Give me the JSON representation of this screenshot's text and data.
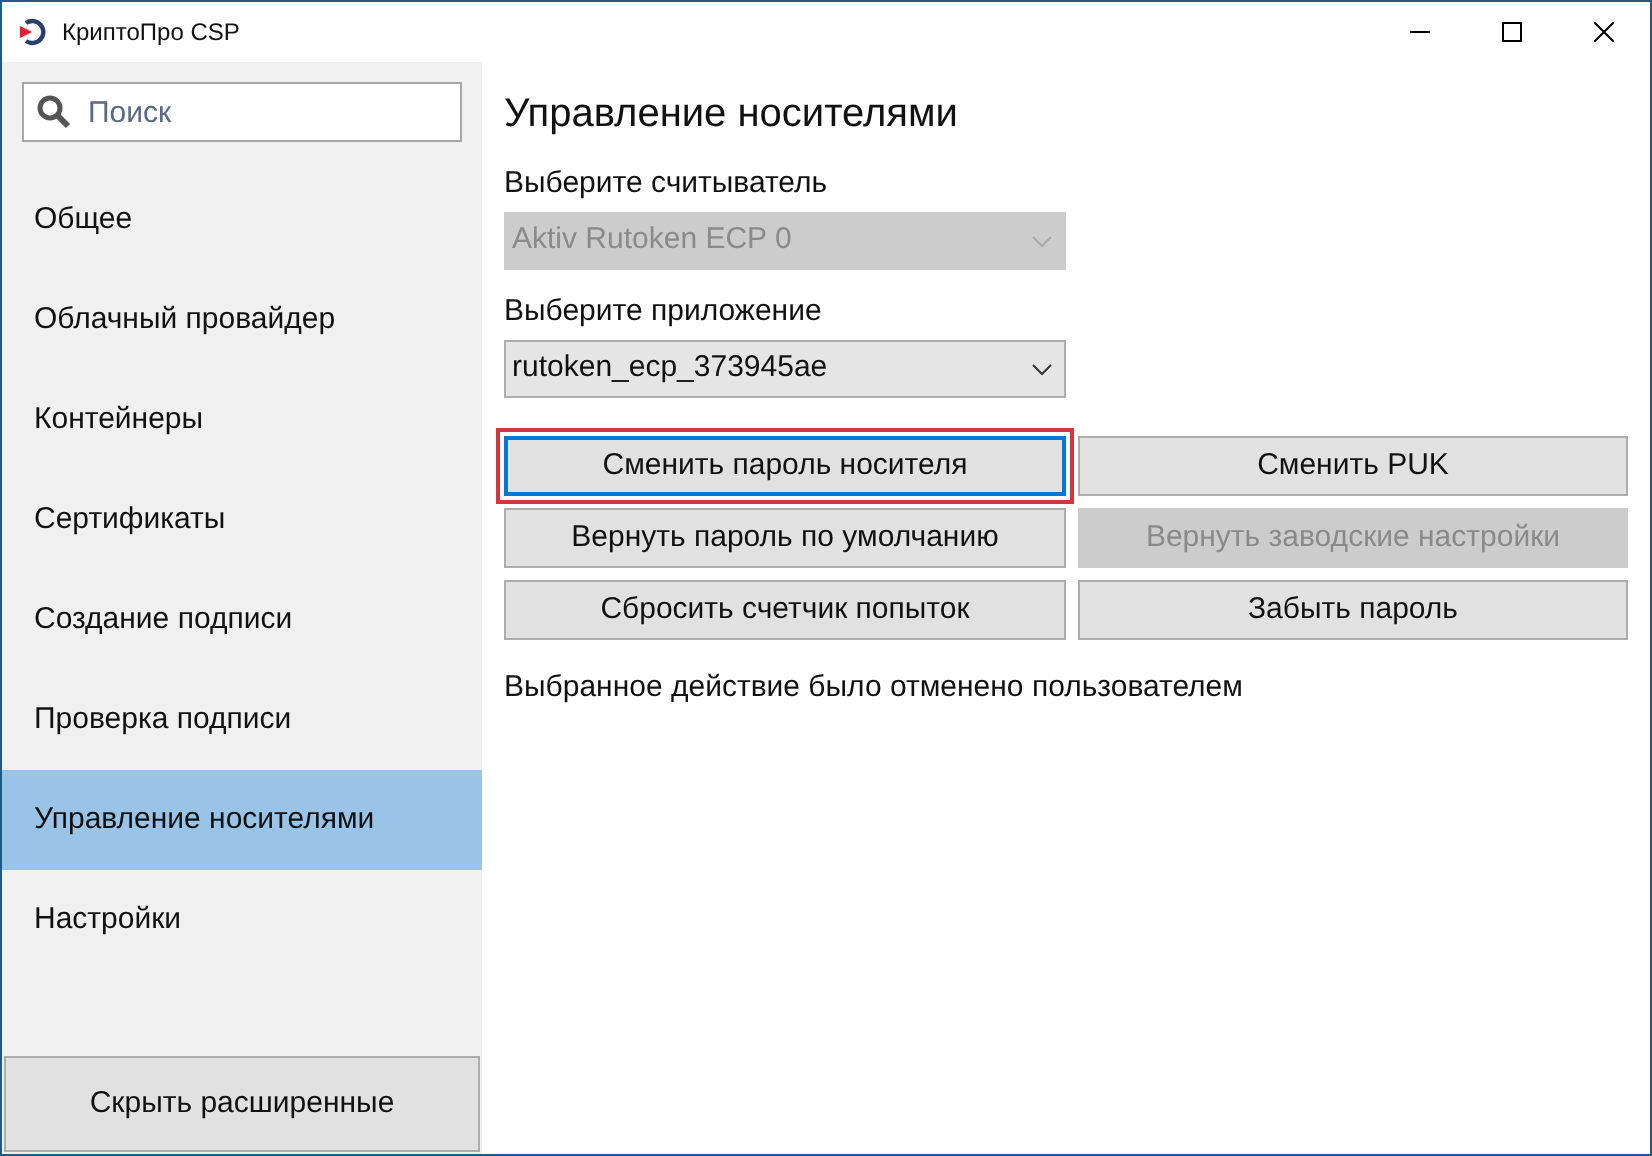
{
  "window": {
    "title": "КриптоПро CSP"
  },
  "sidebar": {
    "search": {
      "placeholder": "Поиск"
    },
    "items": [
      {
        "label": "Общее",
        "selected": false
      },
      {
        "label": "Облачный провайдер",
        "selected": false
      },
      {
        "label": "Контейнеры",
        "selected": false
      },
      {
        "label": "Сертификаты",
        "selected": false
      },
      {
        "label": "Создание подписи",
        "selected": false
      },
      {
        "label": "Проверка подписи",
        "selected": false
      },
      {
        "label": "Управление носителями",
        "selected": true
      },
      {
        "label": "Настройки",
        "selected": false
      }
    ],
    "bottom_button": "Скрыть расширенные"
  },
  "main": {
    "heading": "Управление носителями",
    "fields": [
      {
        "label": "Выберите считыватель",
        "value": "Aktiv Rutoken ECP 0",
        "disabled": true
      },
      {
        "label": "Выберите приложение",
        "value": "rutoken_ecp_373945ae",
        "disabled": false
      }
    ],
    "buttons": [
      {
        "label": "Сменить пароль носителя",
        "disabled": false,
        "focused": true,
        "highlighted": true
      },
      {
        "label": "Сменить PUK",
        "disabled": false,
        "focused": false,
        "highlighted": false
      },
      {
        "label": "Вернуть пароль по умолчанию",
        "disabled": false,
        "focused": false,
        "highlighted": false
      },
      {
        "label": "Вернуть заводские настройки",
        "disabled": true,
        "focused": false,
        "highlighted": false
      },
      {
        "label": "Сбросить счетчик попыток",
        "disabled": false,
        "focused": false,
        "highlighted": false
      },
      {
        "label": "Забыть пароль",
        "disabled": false,
        "focused": false,
        "highlighted": false
      }
    ],
    "status": "Выбранное действие было отменено пользователем"
  }
}
